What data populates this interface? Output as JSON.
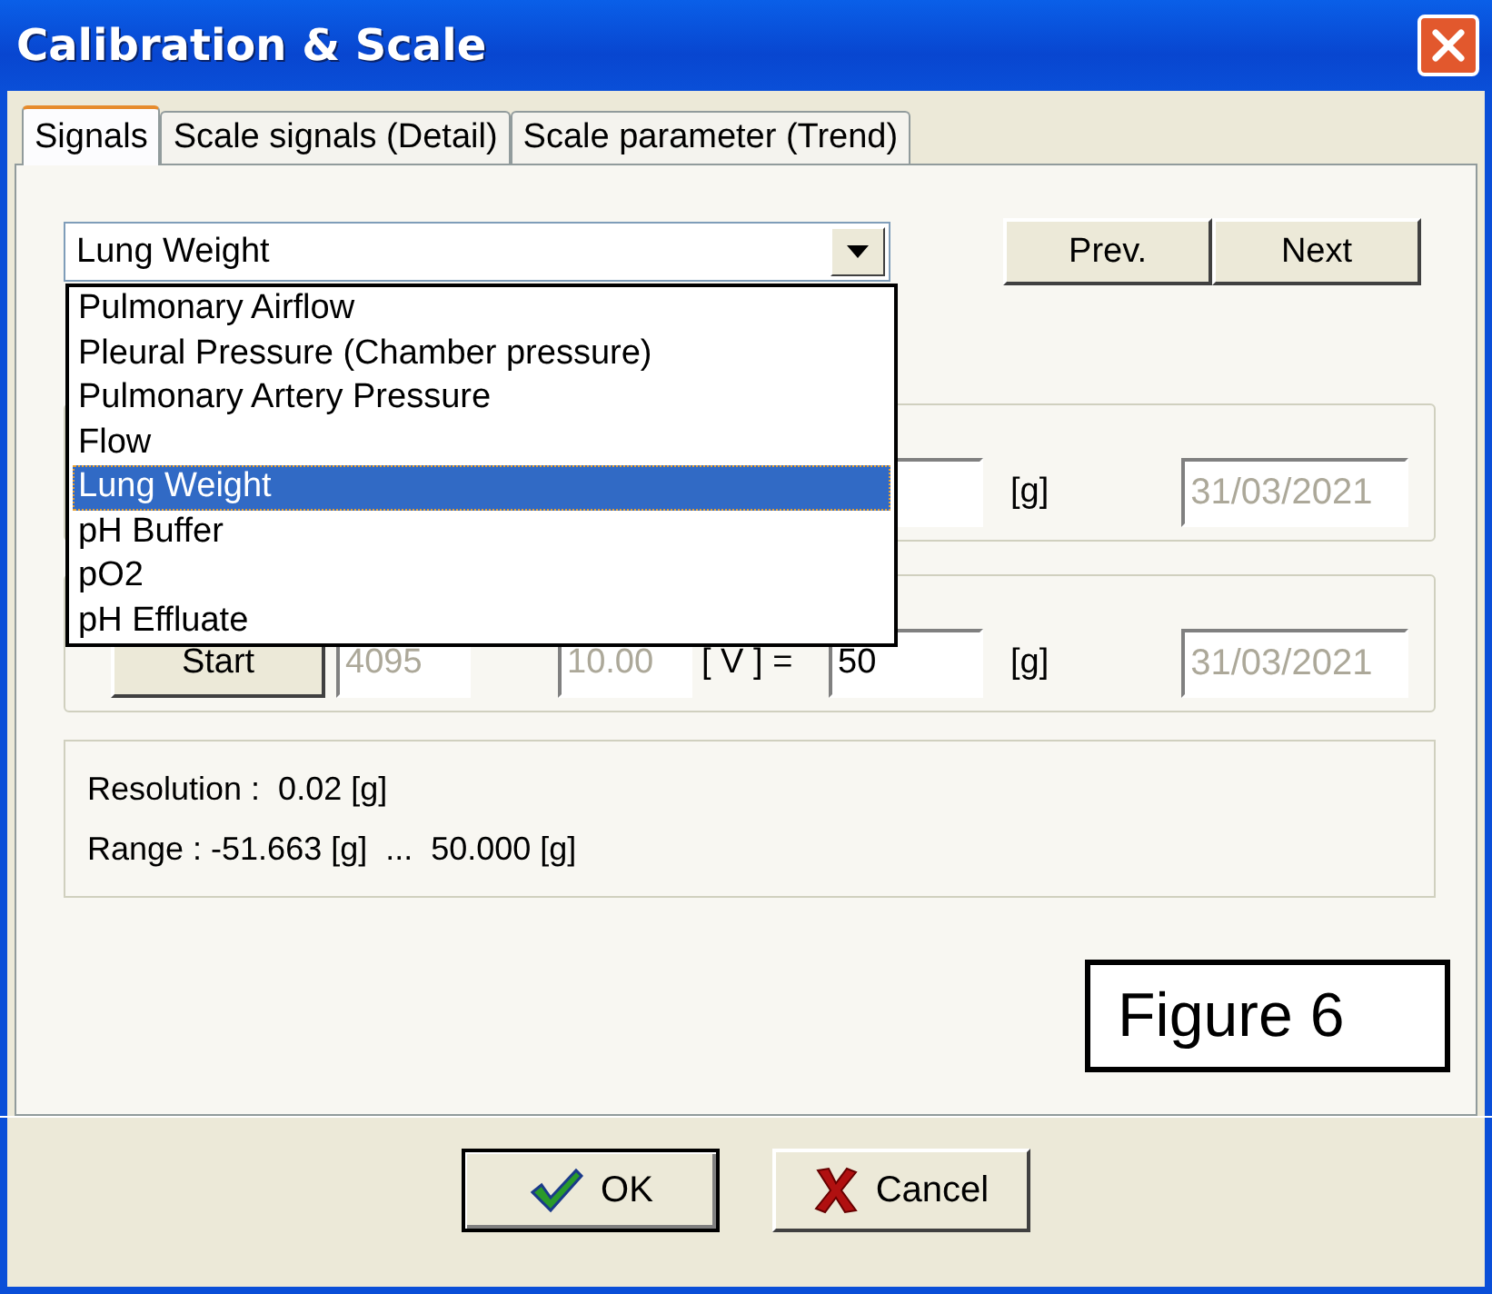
{
  "window": {
    "title": "Calibration & Scale"
  },
  "tabs": [
    {
      "label": "Signals",
      "selected": true
    },
    {
      "label": "Scale signals (Detail)",
      "selected": false
    },
    {
      "label": "Scale parameter (Trend)",
      "selected": false
    }
  ],
  "signal_select": {
    "value": "Lung Weight",
    "expanded": true
  },
  "dropdown_items": [
    {
      "label": "Pulmonary Airflow",
      "selected": false
    },
    {
      "label": "Pleural Pressure (Chamber pressure)",
      "selected": false
    },
    {
      "label": "Pulmonary Artery Pressure",
      "selected": false
    },
    {
      "label": "Flow",
      "selected": false
    },
    {
      "label": "Lung Weight",
      "selected": true
    },
    {
      "label": "pH Buffer",
      "selected": false
    },
    {
      "label": "pO2",
      "selected": false
    },
    {
      "label": "pH Effluate",
      "selected": false
    }
  ],
  "nav_buttons": [
    "Prev.",
    "Next"
  ],
  "group_1": {
    "unit": "[g]",
    "date": {
      "value": "31/03/2021",
      "disabled": true
    }
  },
  "group_2": {
    "start_button": "Start",
    "raw_field": {
      "value": "4095",
      "disabled": true
    },
    "volt_field": {
      "value": "10.00",
      "disabled": true
    },
    "equation_label": "[ V ] =",
    "value_field": {
      "value": "50",
      "disabled": false
    },
    "unit": "[g]",
    "date": {
      "value": "31/03/2021",
      "disabled": true
    }
  },
  "info": {
    "resolution": "Resolution :  0.02 [g]",
    "range": "Range : -51.663 [g]  ...  50.000 [g]"
  },
  "figure_label": "Figure 6",
  "buttons": [
    {
      "label": "OK",
      "kind": "ok"
    },
    {
      "label": "Cancel",
      "kind": "cancel"
    }
  ]
}
